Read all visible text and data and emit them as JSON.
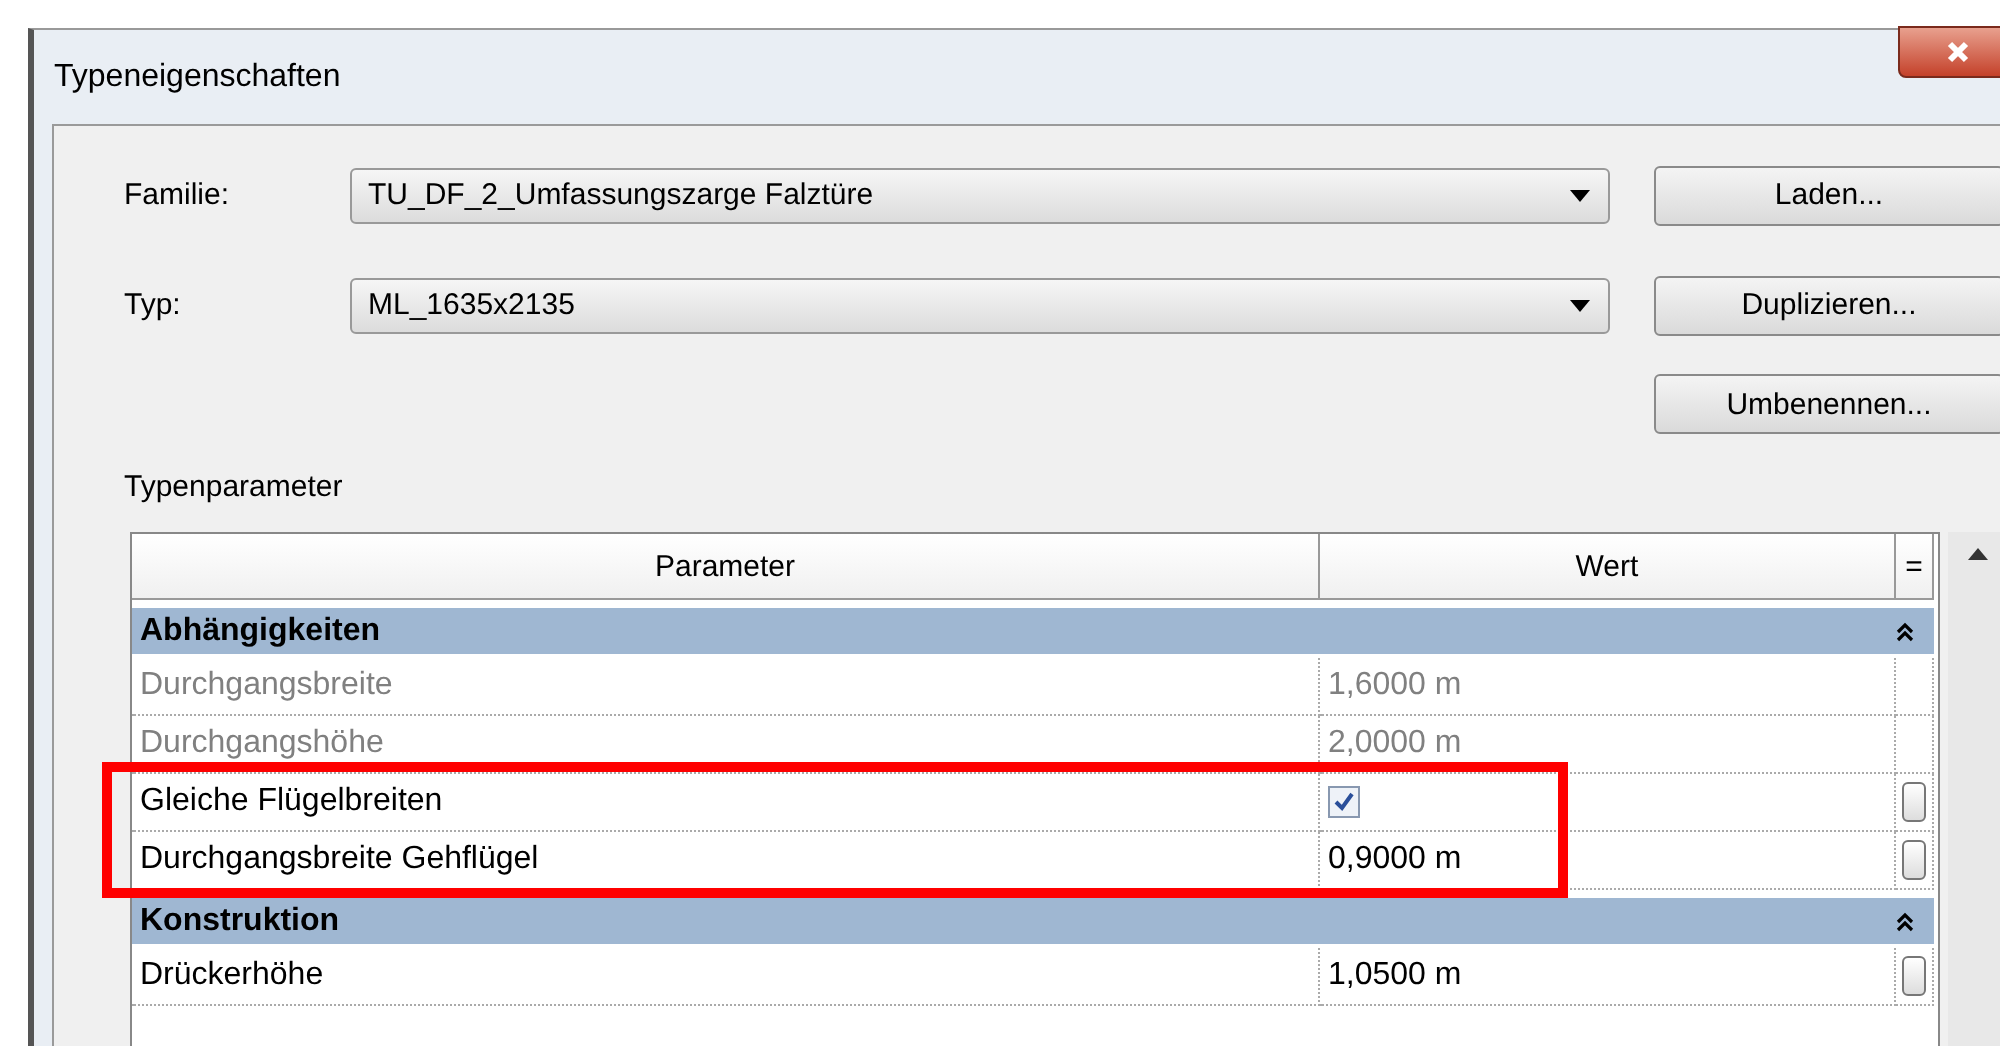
{
  "window": {
    "title": "Typeneigenschaften"
  },
  "fields": [
    {
      "label": "Familie:",
      "value": "TU_DF_2_Umfassungszarge Falztüre",
      "button": "Laden..."
    },
    {
      "label": "Typ:",
      "value": "ML_1635x2135",
      "button": "Duplizieren..."
    }
  ],
  "extra_button": "Umbenennen...",
  "section_label": "Typenparameter",
  "table": {
    "columns": [
      "Parameter",
      "Wert",
      "="
    ],
    "rows": [
      {
        "kind": "group",
        "label": "Abhängigkeiten"
      },
      {
        "kind": "value",
        "label": "Durchgangsbreite",
        "value": "1,6000 m",
        "disabled": true,
        "linkable": false,
        "highlighted": false
      },
      {
        "kind": "value",
        "label": "Durchgangshöhe",
        "value": "2,0000 m",
        "disabled": true,
        "linkable": false,
        "highlighted": false
      },
      {
        "kind": "checkbox",
        "label": "Gleiche Flügelbreiten",
        "checked": true,
        "disabled": false,
        "linkable": true,
        "highlighted": true
      },
      {
        "kind": "value",
        "label": "Durchgangsbreite Gehflügel",
        "value": "0,9000 m",
        "disabled": false,
        "linkable": true,
        "highlighted": true
      },
      {
        "kind": "group",
        "label": "Konstruktion"
      },
      {
        "kind": "value",
        "label": "Drückerhöhe",
        "value": "1,0500 m",
        "disabled": false,
        "linkable": true,
        "highlighted": false
      }
    ]
  }
}
